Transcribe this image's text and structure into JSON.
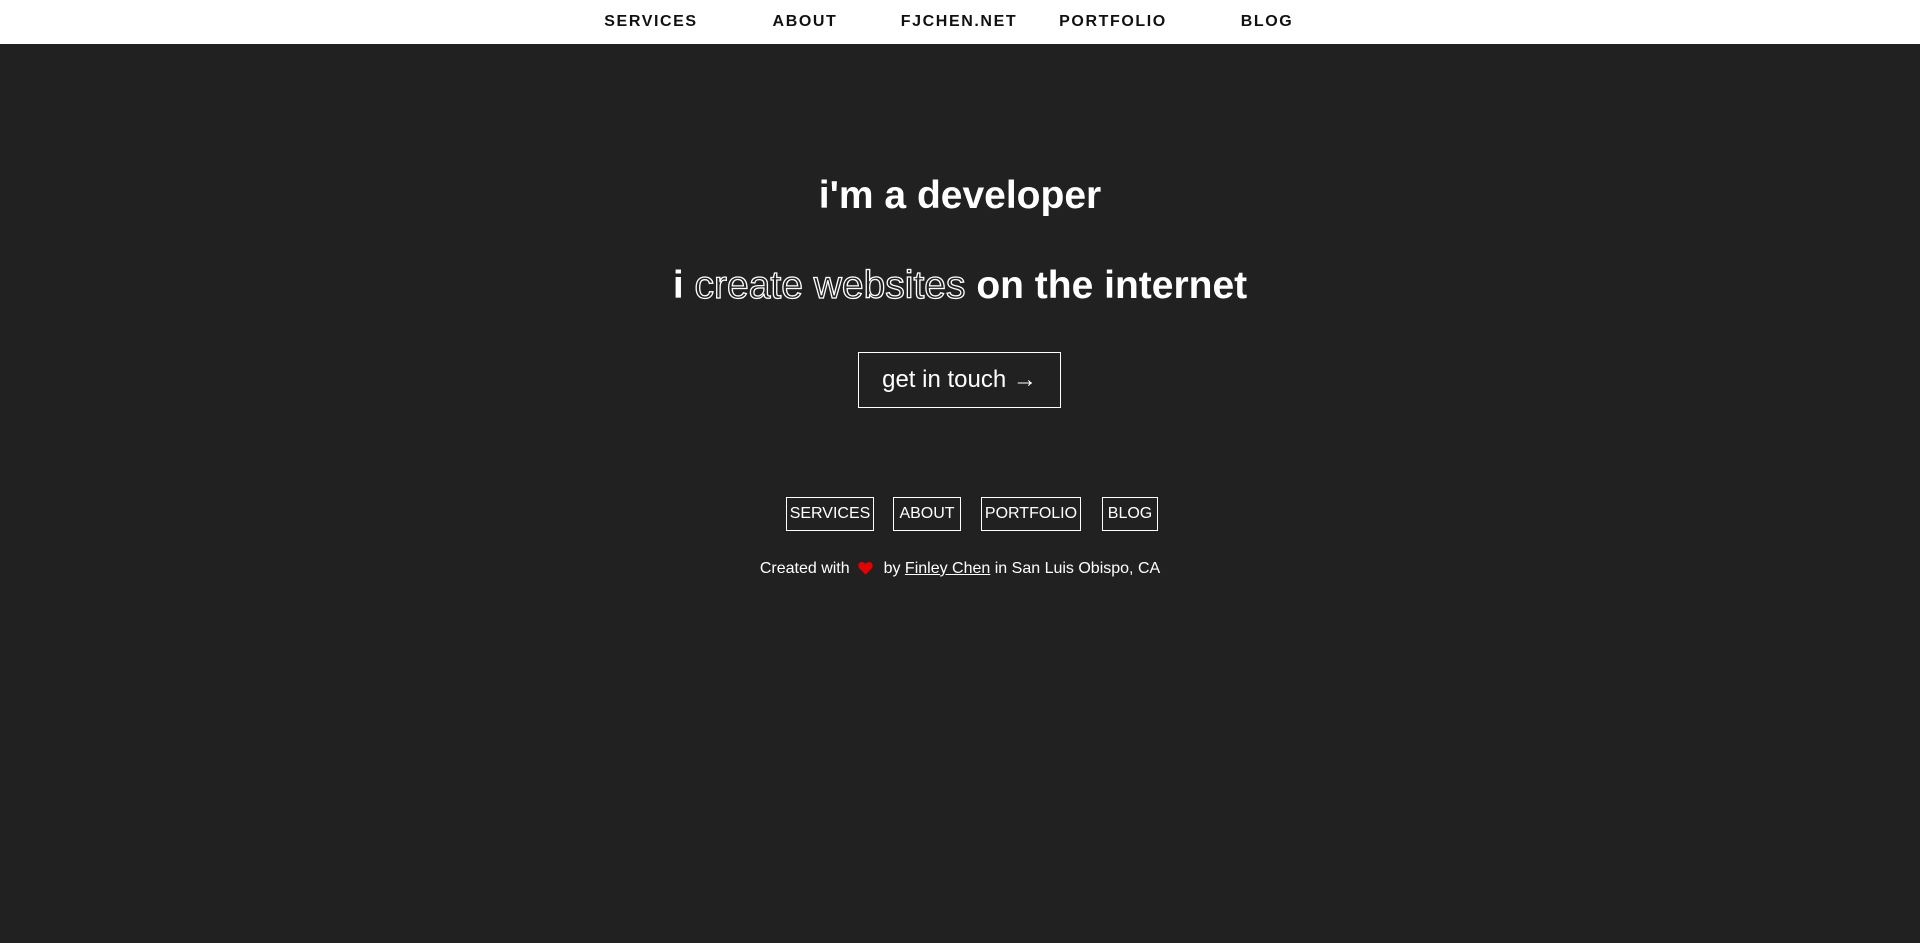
{
  "topnav": {
    "items": [
      {
        "label": "SERVICES"
      },
      {
        "label": "ABOUT"
      },
      {
        "label": "FJCHEN.NET"
      },
      {
        "label": "PORTFOLIO"
      },
      {
        "label": "BLOG"
      }
    ]
  },
  "hero": {
    "line1": "i'm a developer",
    "line2_prefix": "i",
    "line2_outlined": "create websites",
    "line2_suffix": "on the internet",
    "cta_label": "get in touch →"
  },
  "footer": {
    "nav": [
      {
        "label": "SERVICES"
      },
      {
        "label": "ABOUT"
      },
      {
        "label": "PORTFOLIO"
      },
      {
        "label": "BLOG"
      }
    ],
    "credit_prefix": "Created with",
    "credit_by": "by",
    "author": "Finley Chen",
    "credit_suffix": "in San Luis Obispo, CA",
    "heart_icon": "heart-icon",
    "heart_color": "#e60000"
  },
  "colors": {
    "background": "#212121",
    "topbar": "#ffffff",
    "text": "#ffffff"
  }
}
